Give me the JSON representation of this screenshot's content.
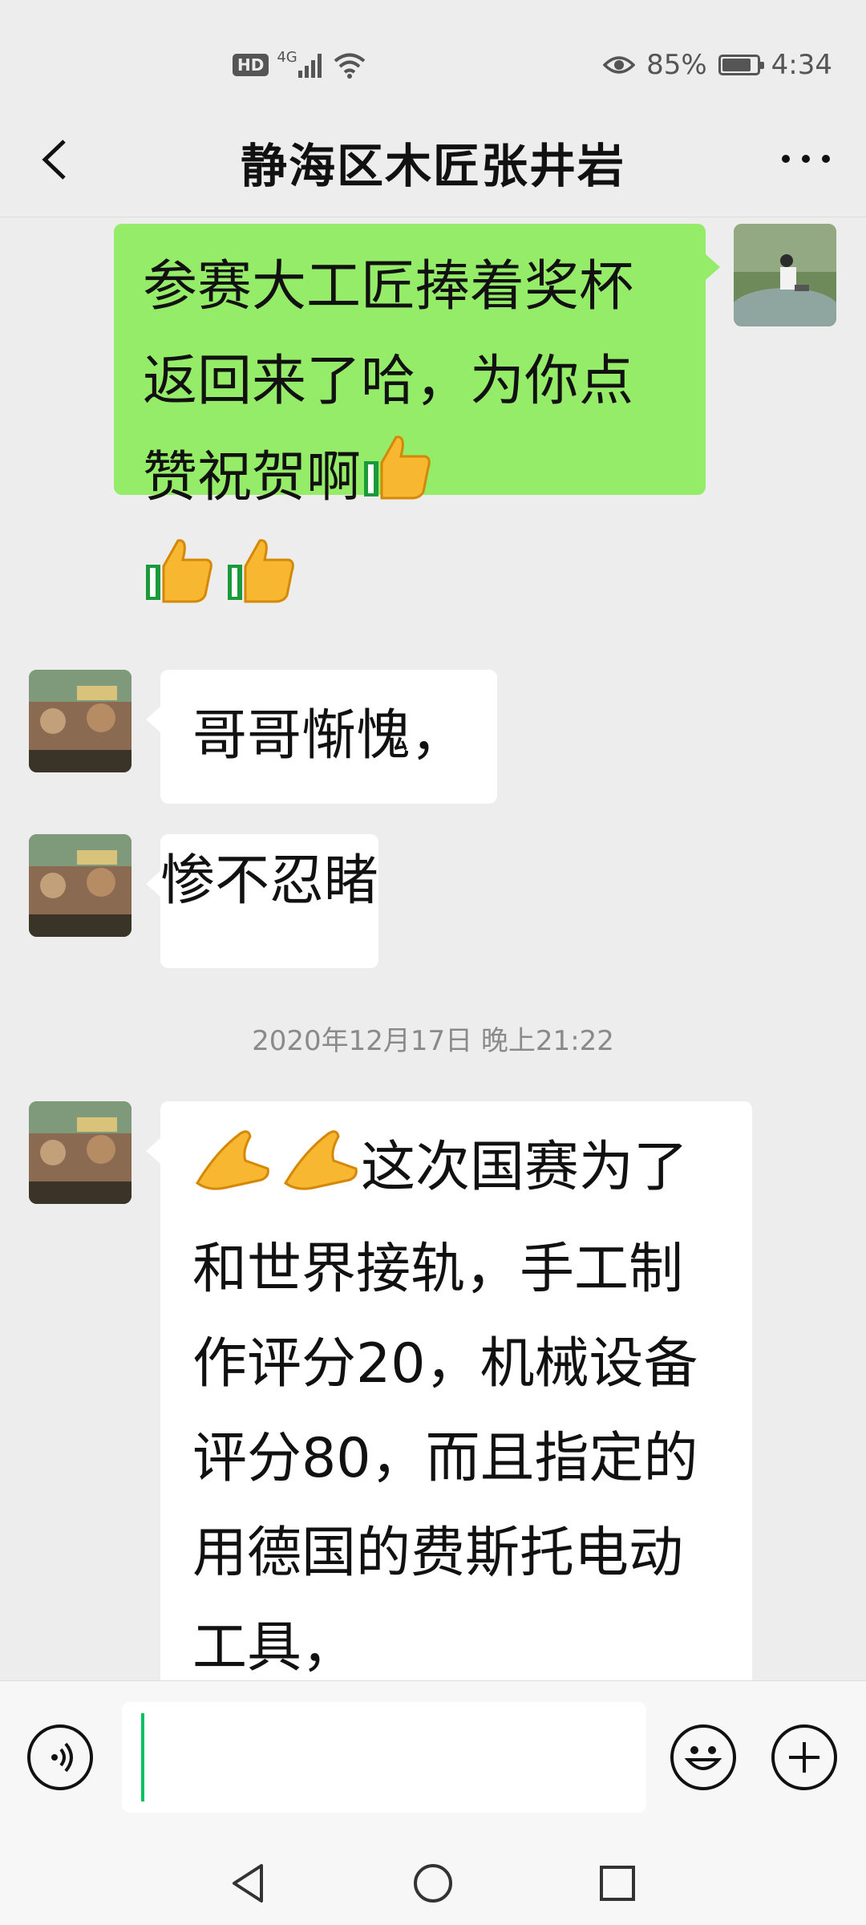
{
  "status_bar": {
    "hd": "HD",
    "network": "4G",
    "battery": "85%",
    "battery_level": 0.85,
    "time": "4:34"
  },
  "header": {
    "title": "静海区木匠张井岩",
    "back_icon": "chevron-left-icon",
    "more_icon": "more-dots-icon"
  },
  "messages": [
    {
      "sender": "me",
      "text": "参赛大工匠捧着奖杯返回来了哈，为你点赞祝贺啊",
      "emoji": "thumbs-up"
    },
    {
      "sender": "them",
      "text": "哥哥惭愧，"
    },
    {
      "sender": "them",
      "text": "惨不忍睹"
    },
    {
      "type": "timestamp",
      "text": "2020年12月17日 晚上21:22"
    },
    {
      "sender": "them",
      "text": "这次国赛为了和世界接轨，手工制作评分20，机械设备评分80，而且指定的用德国的费斯托电动工具，"
    }
  ],
  "input_bar": {
    "voice_icon": "voice-icon",
    "emoji_icon": "smiley-icon",
    "plus_icon": "plus-icon",
    "input_value": ""
  },
  "nav_bar": {
    "back": "triangle-back-icon",
    "home": "circle-home-icon",
    "recent": "square-recent-icon"
  },
  "colors": {
    "background": "#ededed",
    "my_bubble": "#95ec69",
    "their_bubble": "#ffffff",
    "caret": "#07c160"
  }
}
